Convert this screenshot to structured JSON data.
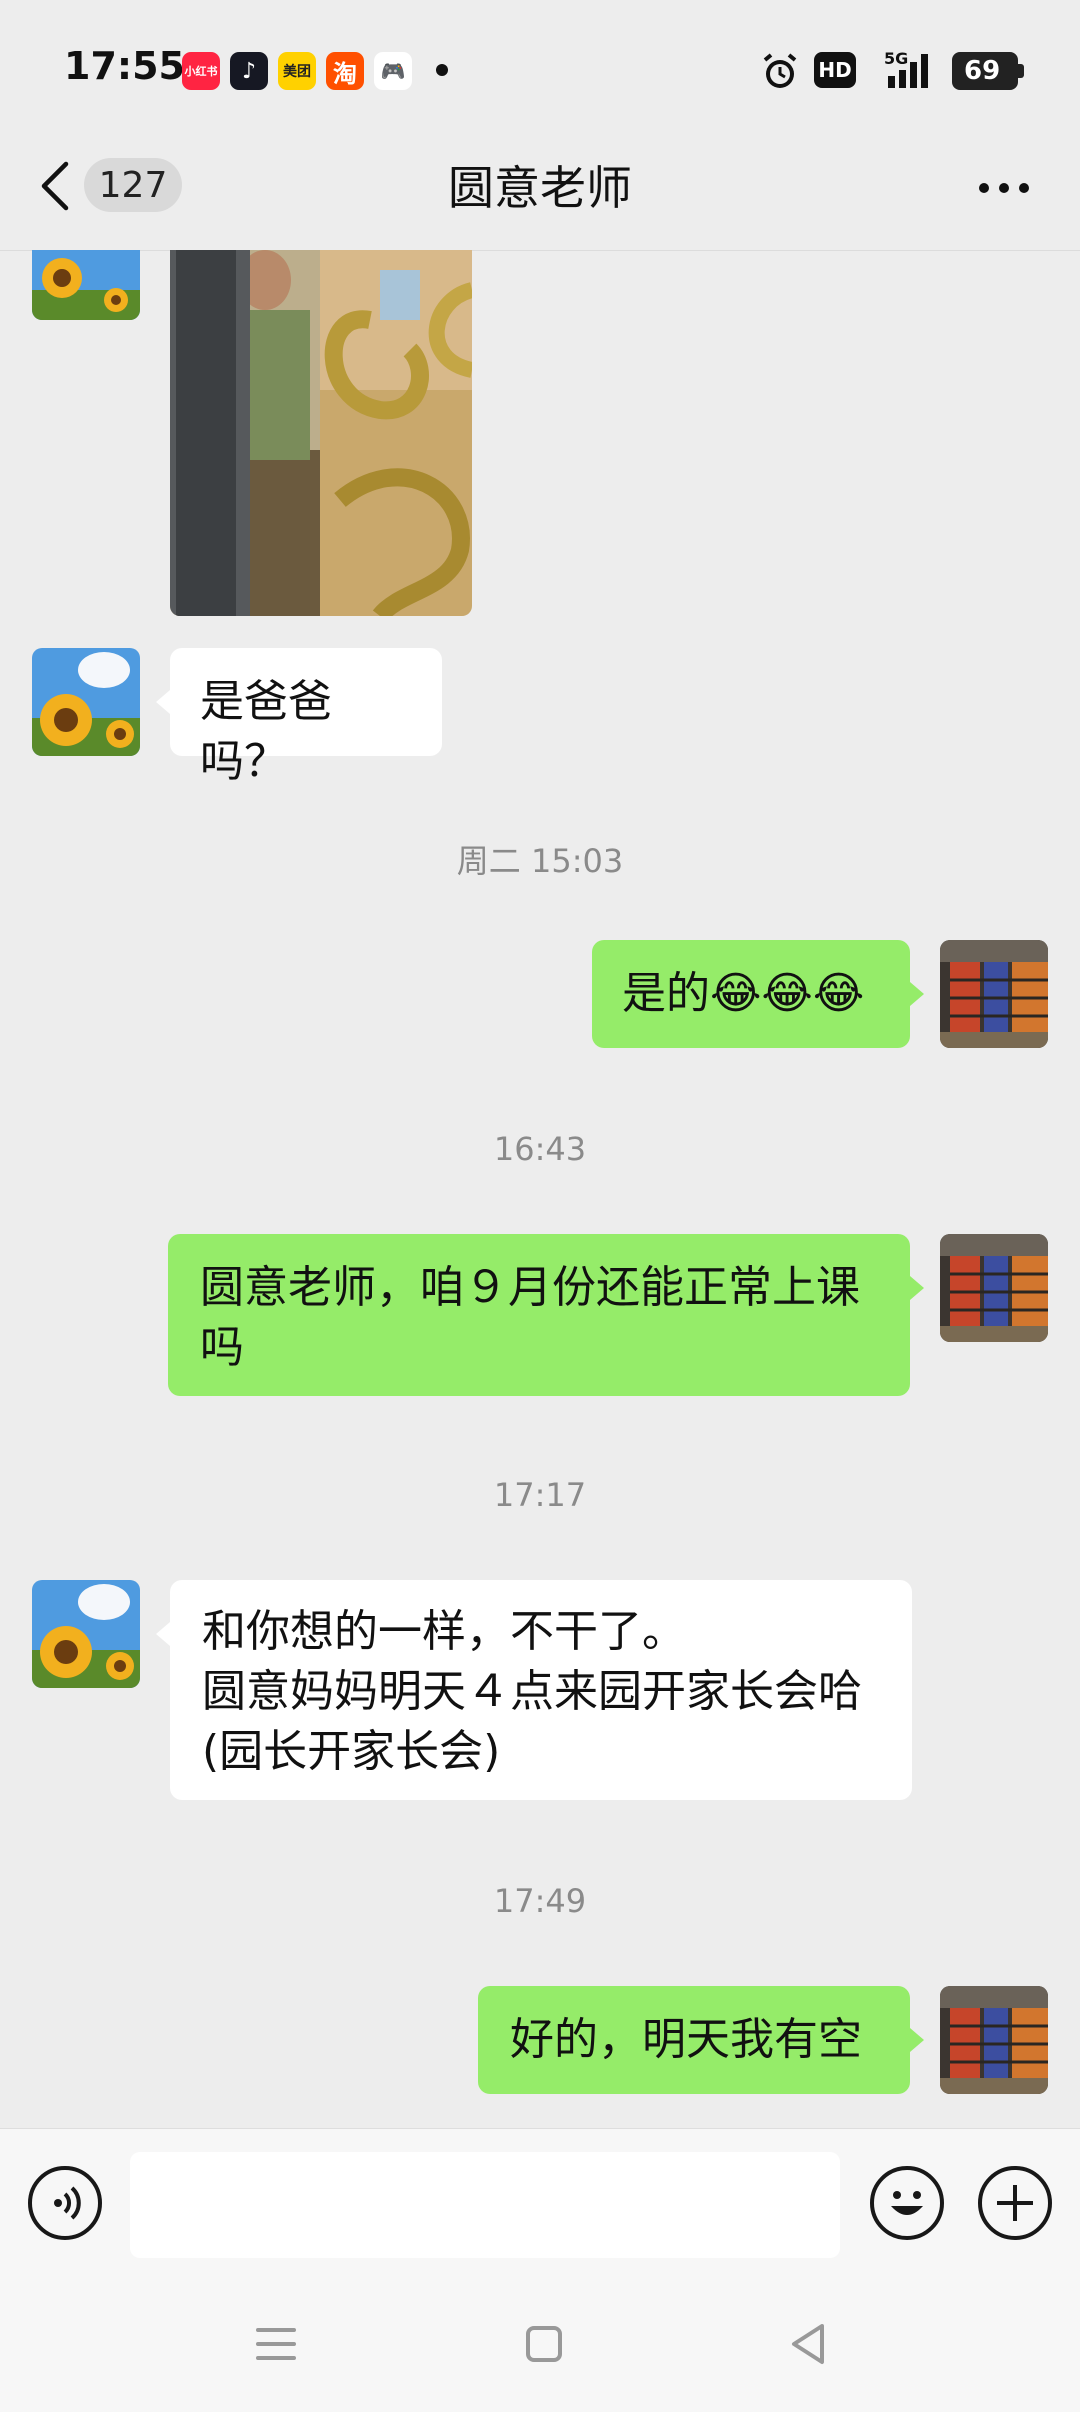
{
  "status_bar": {
    "time": "17:55",
    "apps": [
      {
        "name": "xiaohongshu-icon",
        "label": "小红书",
        "color": "#ff2442"
      },
      {
        "name": "douyin-icon",
        "label": "♪",
        "color": "#161823"
      },
      {
        "name": "meituan-icon",
        "label": "美团",
        "color": "#ffd100"
      },
      {
        "name": "taobao-icon",
        "label": "淘",
        "color": "#ff5000"
      },
      {
        "name": "game-icon",
        "label": "🎮",
        "color": "#ffffff"
      }
    ],
    "network": "5G",
    "hd": "HD",
    "battery": "69"
  },
  "header": {
    "unread_count": "127",
    "title": "圆意老师"
  },
  "messages": [
    {
      "type": "text",
      "from": "teacher",
      "text": "是爸爸吗？"
    },
    {
      "type": "time",
      "text": "周二 15:03"
    },
    {
      "type": "text",
      "from": "me",
      "text": "是的😂😂😂"
    },
    {
      "type": "time",
      "text": "16:43"
    },
    {
      "type": "text",
      "from": "me",
      "text": "圆意老师，咱９月份还能正常上课吗"
    },
    {
      "type": "time",
      "text": "17:17"
    },
    {
      "type": "text",
      "from": "teacher",
      "text": "和你想的一样，不干了。\n圆意妈妈明天４点来园开家长会哈(园长开家长会)"
    },
    {
      "type": "time",
      "text": "17:49"
    },
    {
      "type": "text",
      "from": "me",
      "text": "好的，明天我有空"
    }
  ],
  "colors": {
    "bubble_out": "#95ec69",
    "bubble_in": "#ffffff",
    "background": "#ededed"
  }
}
